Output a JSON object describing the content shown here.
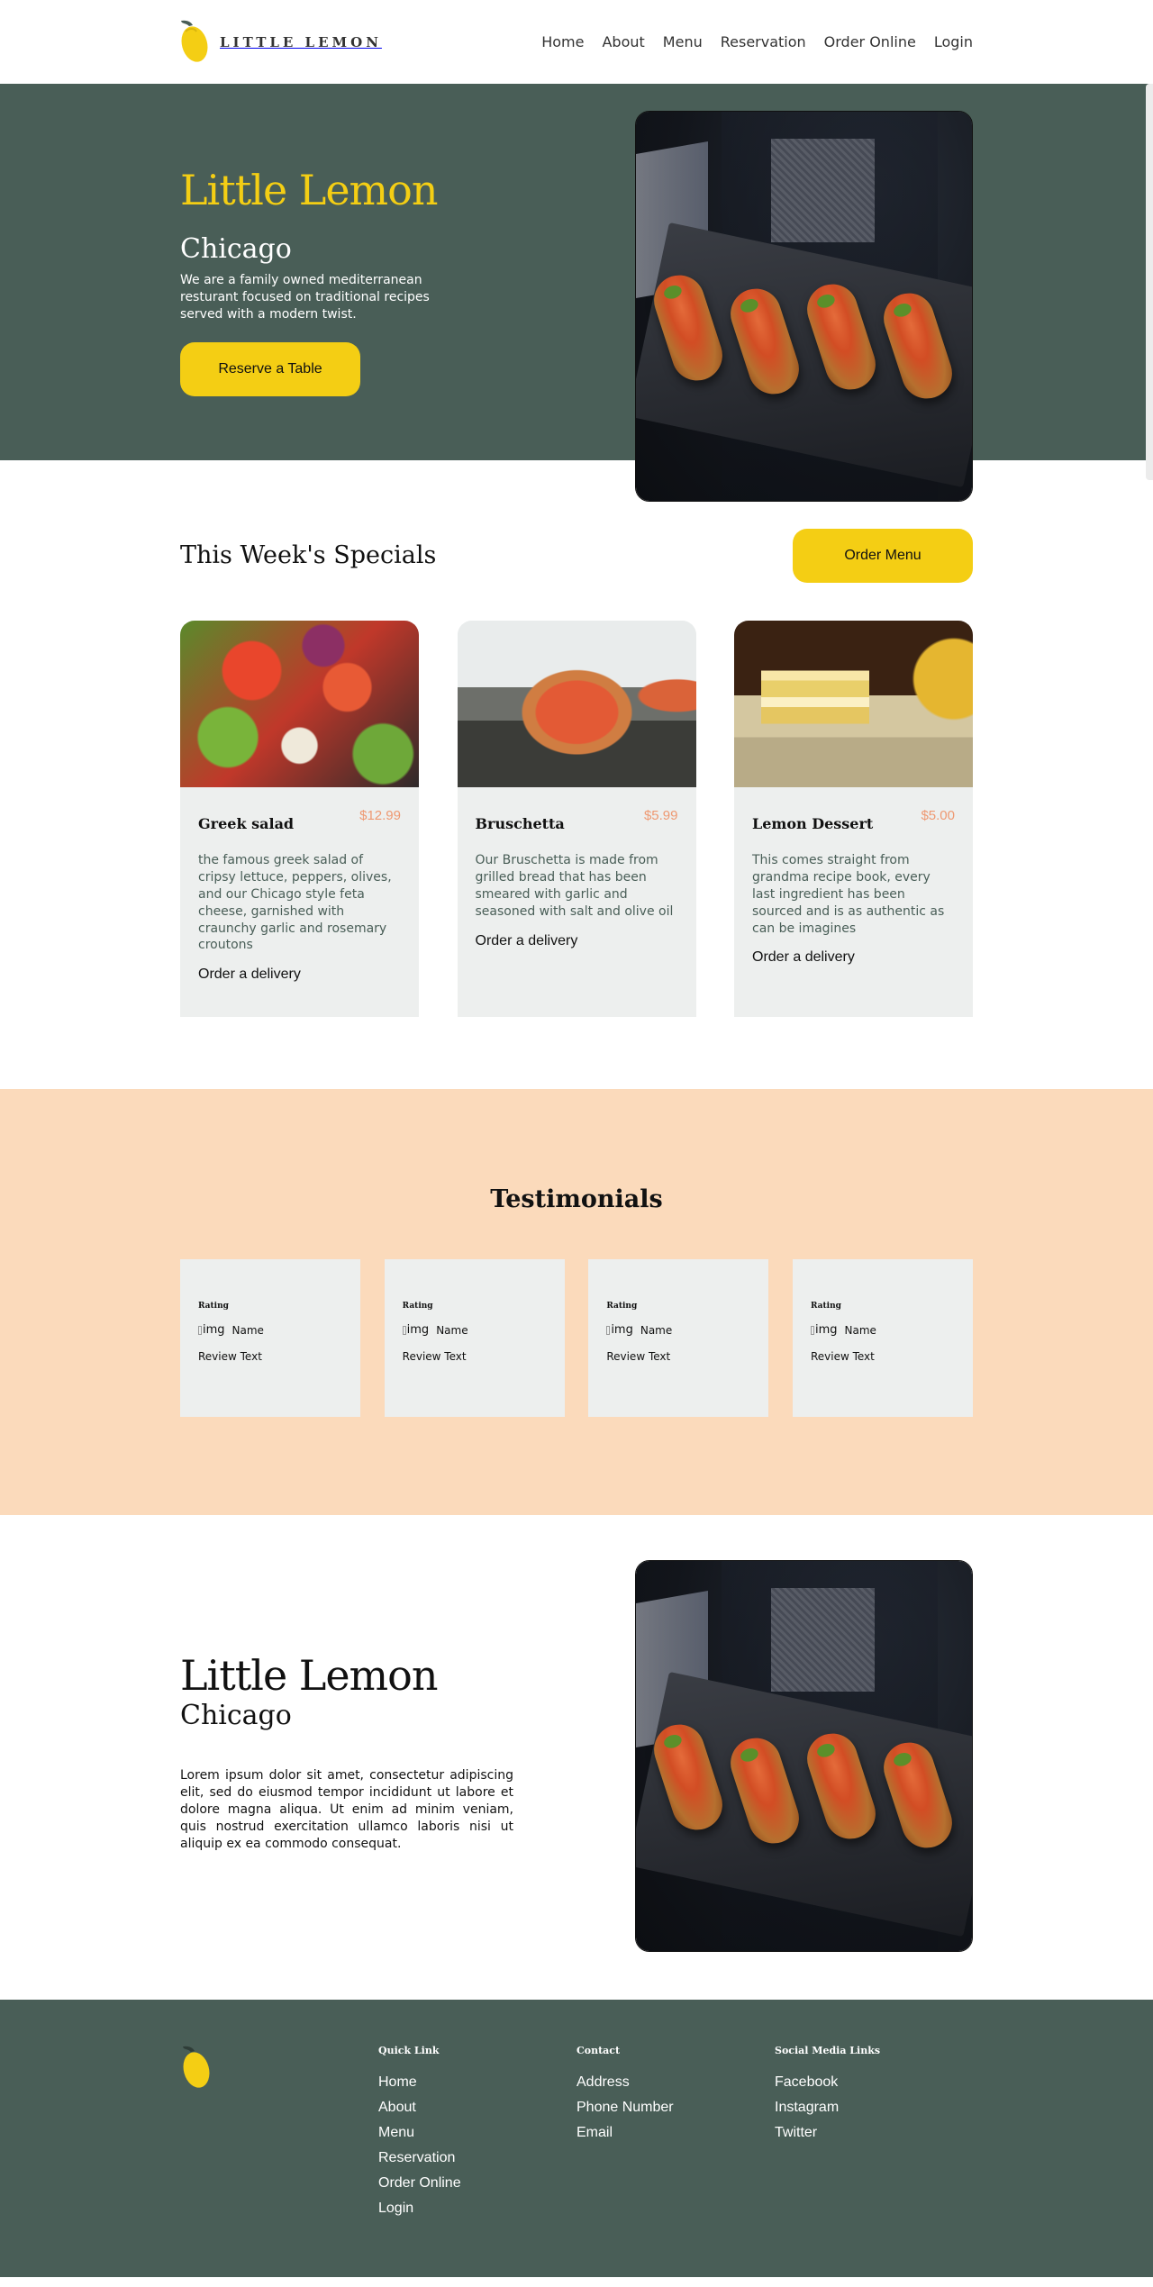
{
  "nav": {
    "brand": "LITTLE LEMON",
    "links": [
      "Home",
      "About",
      "Menu",
      "Reservation",
      "Order Online",
      "Login"
    ]
  },
  "hero": {
    "title": "Little Lemon",
    "subtitle": "Chicago",
    "description": "We are a family owned mediterranean resturant focused on traditional recipes served with a modern twist.",
    "cta": "Reserve a Table"
  },
  "specials": {
    "title": "This Week's Specials",
    "cta": "Order Menu",
    "items": [
      {
        "name": "Greek salad",
        "price": "$12.99",
        "description": "the famous greek salad of cripsy lettuce, peppers, olives, and our Chicago style feta cheese, garnished with craunchy garlic and rosemary croutons",
        "link": "Order a delivery"
      },
      {
        "name": "Bruschetta",
        "price": "$5.99",
        "description": "Our Bruschetta is made from grilled bread that has been smeared with garlic and seasoned with salt and olive oil",
        "link": "Order a delivery"
      },
      {
        "name": "Lemon Dessert",
        "price": "$5.00",
        "description": "This comes straight from grandma recipe book, every last ingredient has been sourced and is as authentic as can be imagines",
        "link": "Order a delivery"
      }
    ]
  },
  "testimonials": {
    "title": "Testimonials",
    "items": [
      {
        "rating": "Rating",
        "img_alt": "img",
        "name": "Name",
        "review": "Review Text"
      },
      {
        "rating": "Rating",
        "img_alt": "img",
        "name": "Name",
        "review": "Review Text"
      },
      {
        "rating": "Rating",
        "img_alt": "img",
        "name": "Name",
        "review": "Review Text"
      },
      {
        "rating": "Rating",
        "img_alt": "img",
        "name": "Name",
        "review": "Review Text"
      }
    ]
  },
  "about": {
    "title": "Little Lemon",
    "subtitle": "Chicago",
    "text": "Lorem ipsum dolor sit amet, consectetur adipiscing elit, sed do eiusmod tempor incididunt ut labore et dolore magna aliqua. Ut enim ad minim veniam, quis nostrud exercitation ullamco laboris nisi ut aliquip ex ea commodo consequat."
  },
  "footer": {
    "quick_heading": "Quick Link",
    "quick_links": [
      "Home",
      "About",
      "Menu",
      "Reservation",
      "Order Online",
      "Login"
    ],
    "contact_heading": "Contact",
    "contact_links": [
      "Address",
      "Phone Number",
      "Email"
    ],
    "social_heading": "Social Media Links",
    "social_links": [
      "Facebook",
      "Instagram",
      "Twitter"
    ]
  },
  "colors": {
    "primary_green": "#495e57",
    "primary_yellow": "#f4ce14",
    "salmon": "#fbdabb",
    "price_orange": "#ee9972",
    "card_gray": "#edefee"
  },
  "icons": {
    "logo": "lemon-logo-icon"
  }
}
